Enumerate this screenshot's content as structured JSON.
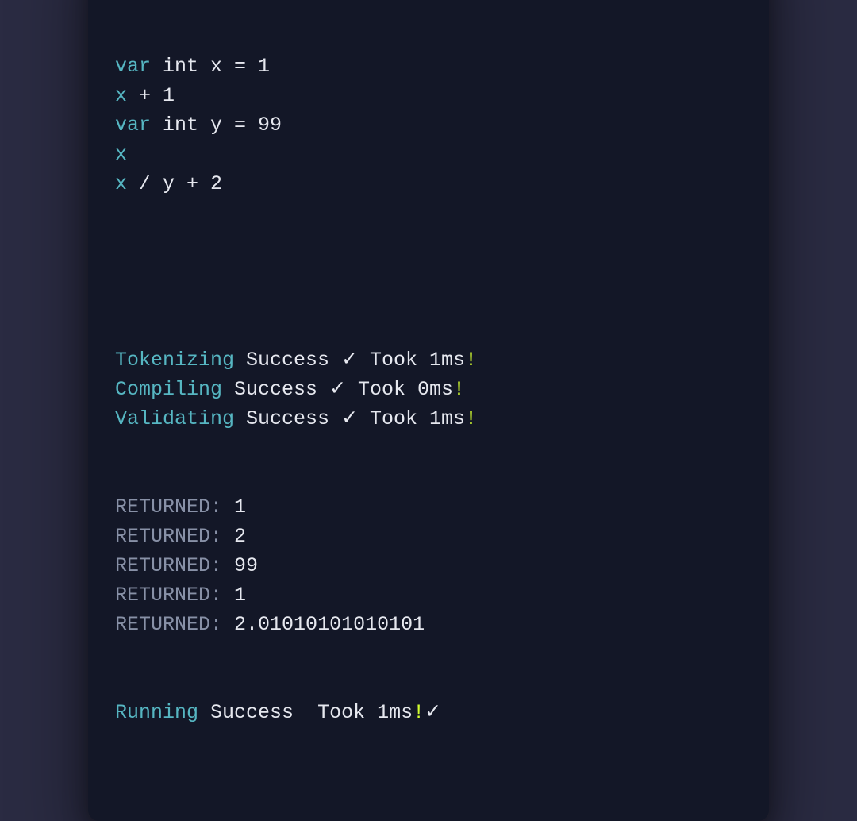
{
  "code": {
    "lines": [
      {
        "segments": [
          {
            "cls": "kw",
            "text": "var"
          },
          {
            "cls": "plain",
            "text": " int x = 1"
          }
        ]
      },
      {
        "segments": [
          {
            "cls": "id",
            "text": "x"
          },
          {
            "cls": "plain",
            "text": " + 1"
          }
        ]
      },
      {
        "segments": [
          {
            "cls": "kw",
            "text": "var"
          },
          {
            "cls": "plain",
            "text": " int y = 99"
          }
        ]
      },
      {
        "segments": [
          {
            "cls": "id",
            "text": "x"
          }
        ]
      },
      {
        "segments": [
          {
            "cls": "id",
            "text": "x"
          },
          {
            "cls": "plain",
            "text": " / y + 2"
          }
        ]
      }
    ]
  },
  "stages": [
    {
      "name": "Tokenizing",
      "status": "Success ✓ Took 1ms",
      "bang": "!",
      "suffix": ""
    },
    {
      "name": "Compiling",
      "status": "Success ✓ Took 0ms",
      "bang": "!",
      "suffix": ""
    },
    {
      "name": "Validating",
      "status": "Success ✓ Took 1ms",
      "bang": "!",
      "suffix": ""
    }
  ],
  "returns_label": "RETURNED:",
  "returns": [
    "1",
    "2",
    "99",
    "1",
    "2.01010101010101"
  ],
  "running": {
    "name": "Running",
    "status": "Success  Took 1ms",
    "bang": "!",
    "suffix": "✓"
  },
  "traffic_light_colors": {
    "close": "#ff5f56",
    "min": "#ffbd2e",
    "max": "#27c93f"
  }
}
